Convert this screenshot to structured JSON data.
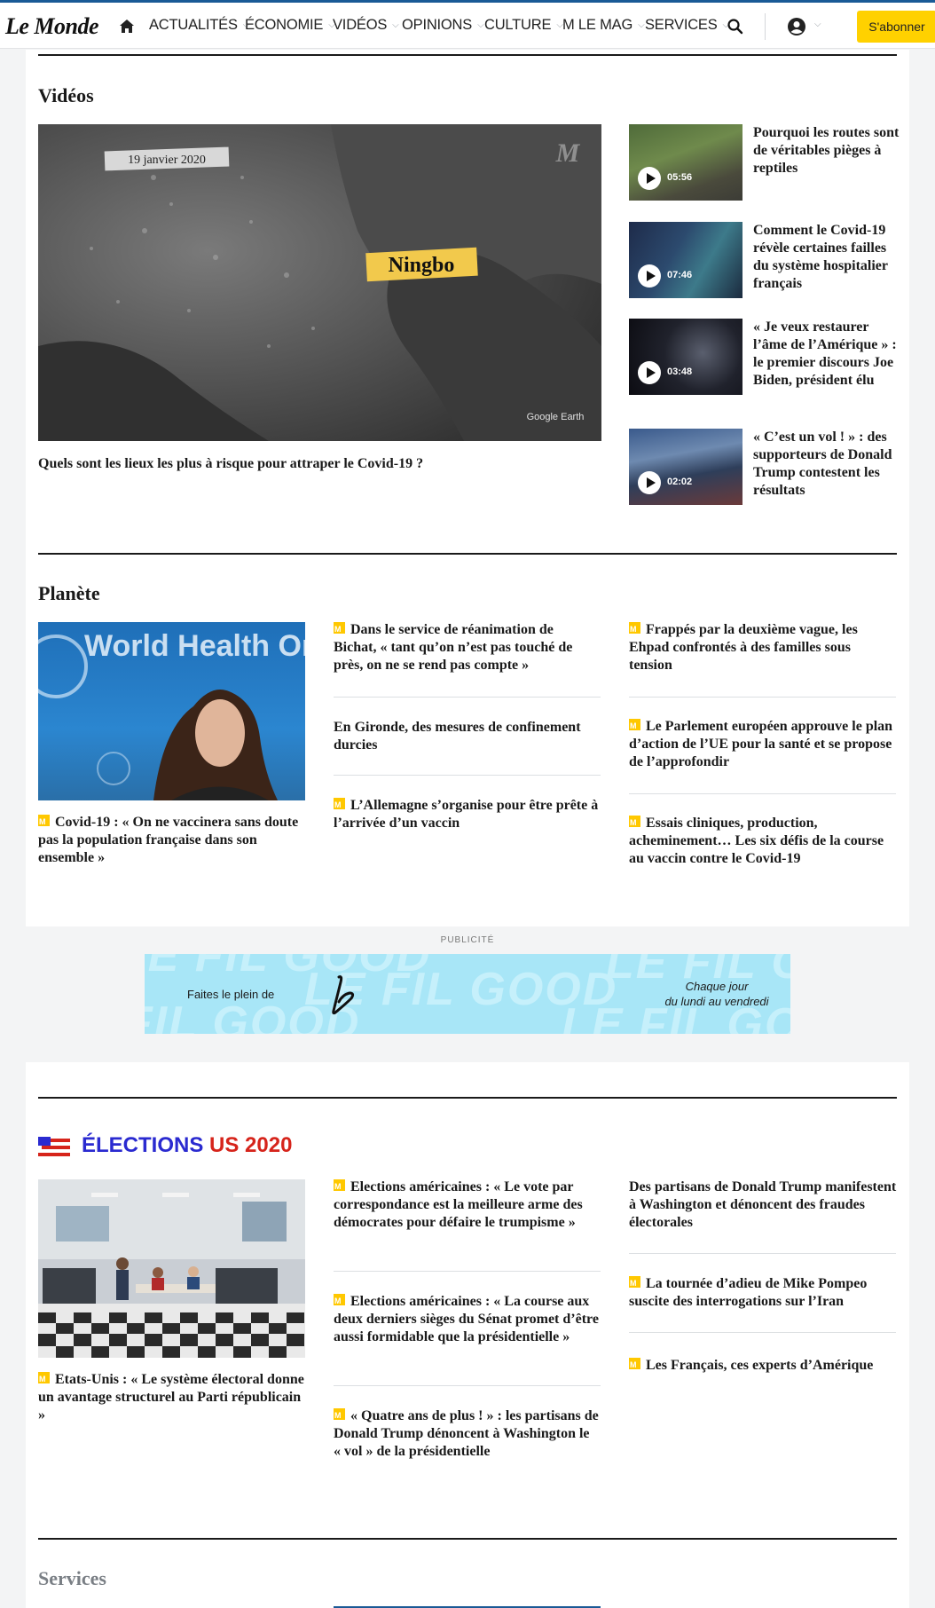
{
  "header": {
    "logo": "Le Monde",
    "nav": [
      "ACTUALITÉS",
      "ÉCONOMIE",
      "VIDÉOS",
      "OPINIONS",
      "CULTURE",
      "M LE MAG",
      "SERVICES"
    ],
    "subscribe_label": "S'abonner"
  },
  "videos": {
    "title": "Vidéos",
    "main": {
      "date_overlay": "19 janvier 2020",
      "place_overlay": "Ningbo",
      "credit": "Google Earth",
      "caption": "Quels sont les lieux les plus à risque pour attraper le Covid-19 ?"
    },
    "items": [
      {
        "duration": "05:56",
        "title": "Pourquoi les routes sont de véritables pièges à reptiles"
      },
      {
        "duration": "07:46",
        "title": "Comment le Covid-19 révèle certaines failles du système hospitalier français"
      },
      {
        "duration": "03:48",
        "title": "« Je veux restaurer l’âme de l’Amérique » : le premier discours Joe Biden, président élu"
      },
      {
        "duration": "02:02",
        "title": "« C’est un vol ! » : des supporteurs de Donald Trump contestent les résultats"
      }
    ]
  },
  "planete": {
    "title": "Planète",
    "image_text": "World Health Organization",
    "main_caption": "Covid-19 : « On ne vaccinera sans doute pas la population française dans son ensemble »",
    "col2": [
      "Dans le service de réanimation de Bichat, « tant qu’on n’est pas touché de près, on ne se rend pas compte »",
      "En Gironde, des mesures de confinement durcies",
      "L’Allemagne s’organise pour être prête à l’arrivée d’un vaccin"
    ],
    "col3": [
      "Frappés par la deuxième vague, les Ehpad confrontés à des familles sous tension",
      "Le Parlement européen approuve le plan d’action de l’UE pour la santé et se propose de l’approfondir",
      "Essais cliniques, production, acheminement… Les six défis de la course au vaccin contre le Covid-19"
    ]
  },
  "ad": {
    "label": "PUBLICITÉ",
    "left_text": "Faites le plein de",
    "bg_text": "LE FIL GOOD",
    "right_line1": "Chaque jour",
    "right_line2": "du lundi au vendredi"
  },
  "elections": {
    "title_a": "ÉLECTIONS",
    "title_b": "US 2020",
    "main_caption": "Etats-Unis : « Le système électoral donne un avantage structurel au Parti républicain »",
    "col2": [
      "Elections américaines : « Le vote par correspondance est la meilleure arme des démocrates pour défaire le trumpisme »",
      "Elections américaines : « La course aux deux derniers sièges du Sénat promet d’être aussi formidable que la présidentielle »",
      "« Quatre ans de plus ! » : les partisans de Donald Trump dénoncent à Washington le « vol » de la présidentielle"
    ],
    "col3": [
      "Des partisans de Donald Trump manifestent à Washington et dénoncent des fraudes électorales",
      "La tournée d’adieu de Mike Pompeo suscite des interrogations sur l’Iran",
      "Les Français, ces experts d’Amérique"
    ]
  },
  "services": {
    "title": "Services"
  },
  "colors": {
    "accent_yellow": "#ffd100",
    "badge_yellow": "#ffc800",
    "elections_blue": "#2a2ad0",
    "elections_red": "#d6241b",
    "ad_bg": "#a8e6f7"
  }
}
